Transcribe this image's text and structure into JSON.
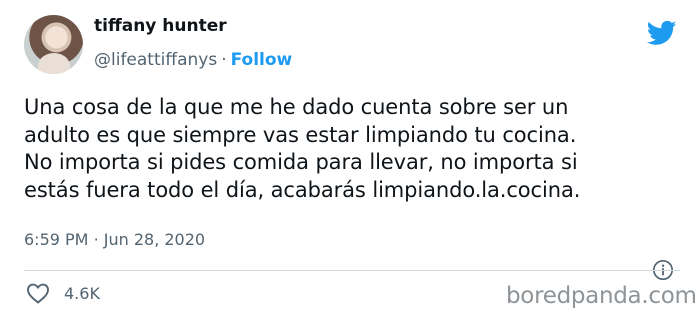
{
  "tweet": {
    "author_name": "tiffany hunter",
    "handle": "@lifeattiffanys",
    "separator": "·",
    "follow_label": "Follow",
    "text": "Una cosa de la que me he dado cuenta sobre ser un\nadulto es que siempre vas estar limpiando tu cocina.\nNo importa si pides comida para llevar, no importa si\nestás fuera todo el día, acabarás limpiando.la.cocina.",
    "time": "6:59 PM",
    "date_separator": "·",
    "date": "Jun 28, 2020",
    "like_count": "4.6K"
  },
  "icons": {
    "brand": "twitter-bird-icon",
    "info": "info-icon",
    "like": "heart-icon"
  },
  "colors": {
    "accent": "#1d9bf0",
    "secondary_text": "#536471",
    "primary_text": "#0f1419"
  },
  "watermark": "boredpanda.com"
}
